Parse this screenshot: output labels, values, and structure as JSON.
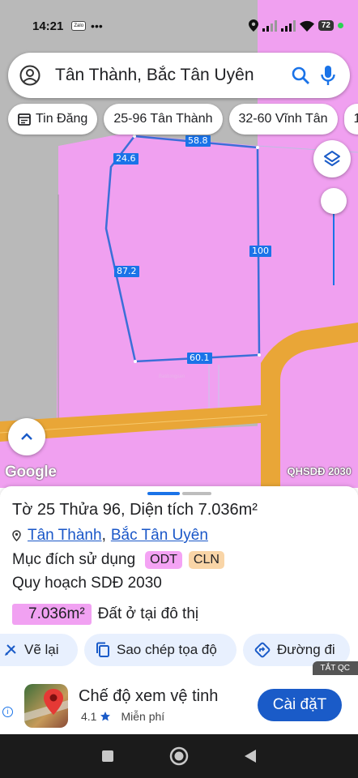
{
  "status_bar": {
    "time": "14:21",
    "zalo": "Zalo",
    "battery": "72"
  },
  "search": {
    "query": "Tân Thành, Bắc Tân Uyên"
  },
  "chips": [
    {
      "label": "Tin Đăng",
      "icon": "news-icon"
    },
    {
      "label": "25-96 Tân Thành"
    },
    {
      "label": "32-60 Vĩnh Tân"
    },
    {
      "label": "1"
    }
  ],
  "map": {
    "dimensions": {
      "top": "58.8",
      "top_left": "24.6",
      "left": "87.2",
      "right": "100",
      "bottom": "60.1"
    },
    "google_logo": "Google",
    "overlay_label": "QHSDĐ 2030",
    "watermark": "Batdongsan",
    "colors": {
      "zone_pink": "#f0a0f0",
      "road": "#e9a637",
      "background": "#b9b9b9",
      "boundary": "#3b6fd8"
    }
  },
  "sheet": {
    "title": "Tờ 25 Thửa 96, Diện tích 7.036m²",
    "location": {
      "ward": "Tân Thành",
      "separator": ",",
      "district": "Bắc Tân Uyên"
    },
    "purpose_label": "Mục đích sử dụng",
    "tags": [
      "ODT",
      "CLN"
    ],
    "plan_label": "Quy hoạch SDĐ 2030",
    "area_value": "7.036m²",
    "area_desc": "Đất ở tại đô thị",
    "actions": [
      {
        "label": "Vẽ lại",
        "icon": "draw-icon"
      },
      {
        "label": "Sao chép tọa độ",
        "icon": "copy-icon"
      },
      {
        "label": "Đường đi",
        "icon": "directions-icon"
      }
    ]
  },
  "ad": {
    "close_label": "TẮT QC",
    "info": "i",
    "app_name": "Chế độ xem vệ tinh",
    "rating": "4.1",
    "price": "Miễn phí",
    "install_label": "Cài đặT"
  }
}
